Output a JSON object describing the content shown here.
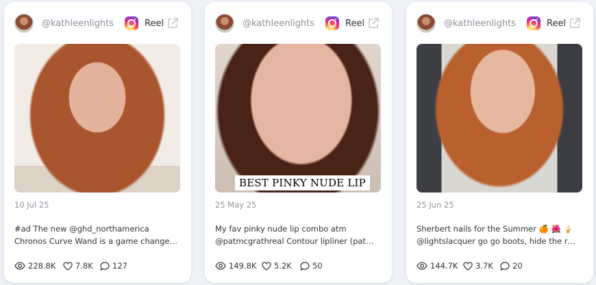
{
  "cards": [
    {
      "handle": "@kathleenlights",
      "platform_icon": "instagram-icon",
      "type_label": "Reel",
      "overlay": "",
      "date": "10 Jul 25",
      "caption": [
        "#ad The new @ghd_northamerica",
        "Chronos Curve Wand is a game change…"
      ],
      "views": "228.8K",
      "likes": "7.8K",
      "comments": "127"
    },
    {
      "handle": "@kathleenlights",
      "platform_icon": "instagram-icon",
      "type_label": "Reel",
      "overlay": "BEST PINKY NUDE LIP",
      "date": "25 May 25",
      "caption": [
        "My fav pinky nude lip combo atm",
        "@patmcgrathreal Contour lipliner (pat…"
      ],
      "views": "149.8K",
      "likes": "5.2K",
      "comments": "50"
    },
    {
      "handle": "@kathleenlights",
      "platform_icon": "instagram-icon",
      "type_label": "Reel",
      "overlay": "",
      "date": "25 Jun 25",
      "caption": [
        "Sherbert nails for the Summer 🍊 🌺 🍦",
        "@lightslacquer go go boots, hide the r…"
      ],
      "views": "144.7K",
      "likes": "3.7K",
      "comments": "20"
    }
  ],
  "colors": {
    "text_muted": "#8f949c",
    "text_main": "#2e3238",
    "card_bg": "#ffffff",
    "page_bg": "#eef1f6"
  }
}
